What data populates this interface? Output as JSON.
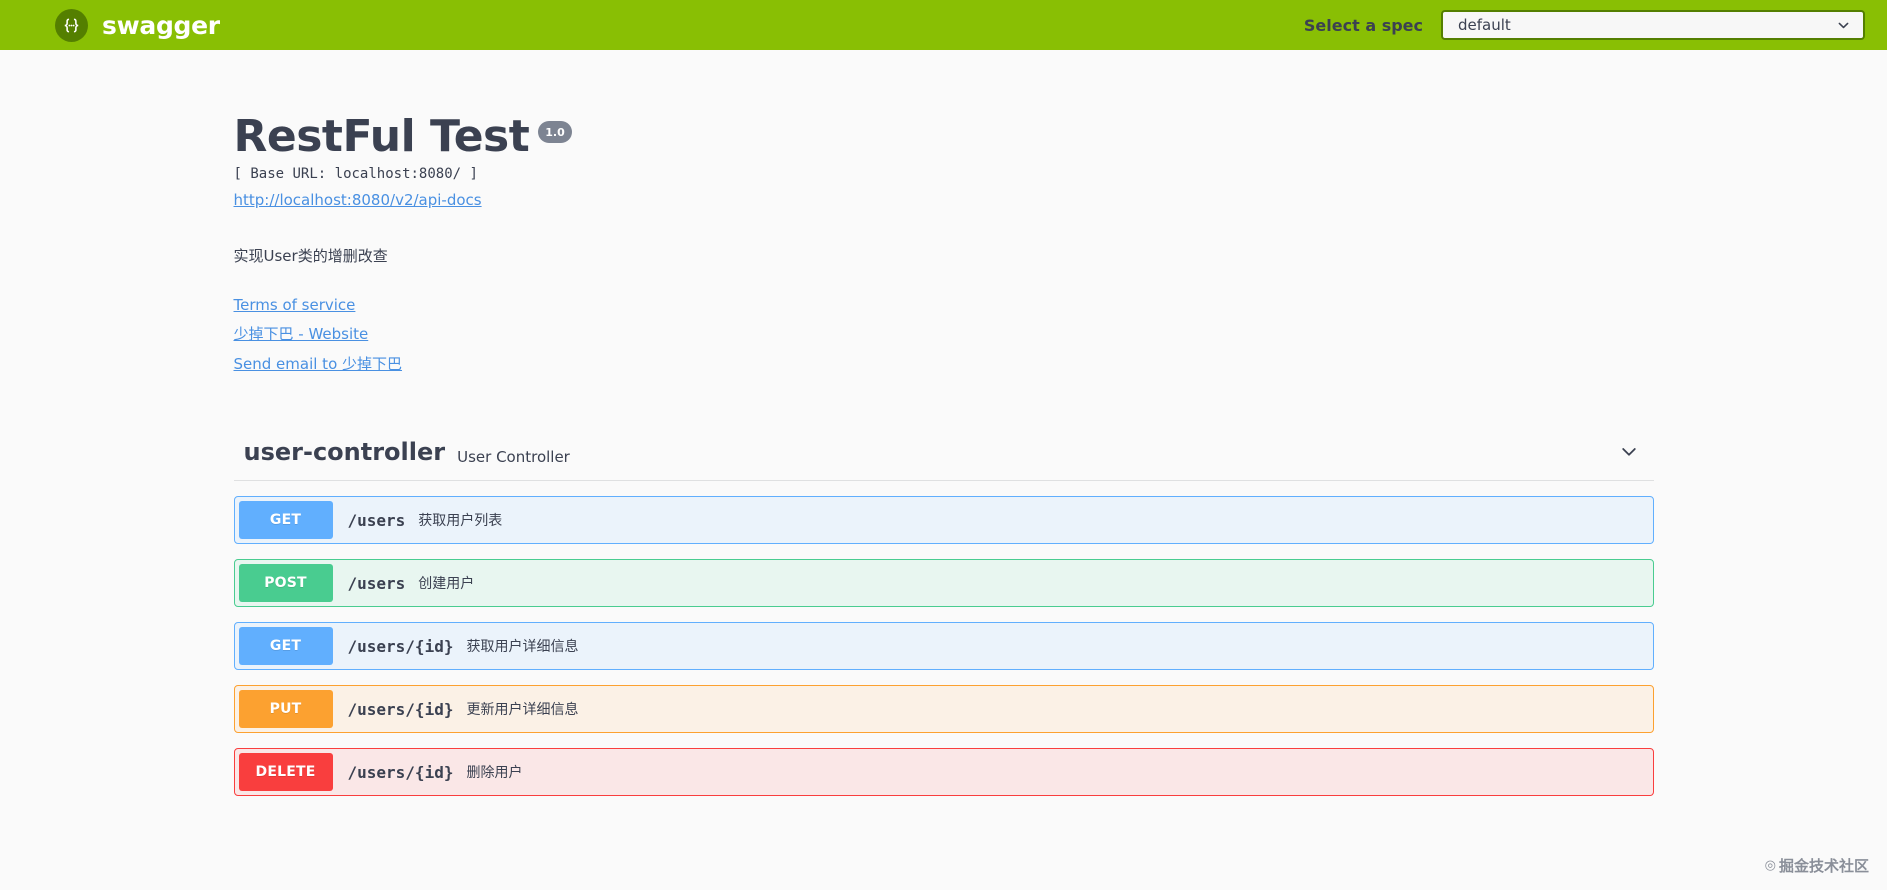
{
  "topbar": {
    "logo_icon": "swagger-braces-logo-icon",
    "logo_text": "swagger",
    "spec_label": "Select a spec",
    "spec_selected": "default",
    "spec_options": [
      "default"
    ],
    "chevron_icon": "chevron-down-icon",
    "background_color": "#89bf04",
    "logo_circle_color": "#547f00"
  },
  "info": {
    "title": "RestFul Test",
    "version": "1.0",
    "base_url": "[ Base URL: localhost:8080/ ]",
    "docs_link": "http://localhost:8080/v2/api-docs",
    "description": "实现User类的增删改查",
    "terms_link": "Terms of service",
    "website_link": "少掉下巴 - Website",
    "email_link": "Send email to 少掉下巴",
    "link_color": "#4990e2",
    "badge_color": "#7d8492"
  },
  "tag": {
    "name": "user-controller",
    "description": "User Controller",
    "toggle_icon": "chevron-down-icon"
  },
  "operations": [
    {
      "method": "GET",
      "path": "/users",
      "summary": "获取用户列表",
      "style": "op-get",
      "color": "#61affe"
    },
    {
      "method": "POST",
      "path": "/users",
      "summary": "创建用户",
      "style": "op-post",
      "color": "#49cc90"
    },
    {
      "method": "GET",
      "path": "/users/{id}",
      "summary": "获取用户详细信息",
      "style": "op-get",
      "color": "#61affe"
    },
    {
      "method": "PUT",
      "path": "/users/{id}",
      "summary": "更新用户详细信息",
      "style": "op-put",
      "color": "#fca130"
    },
    {
      "method": "DELETE",
      "path": "/users/{id}",
      "summary": "删除用户",
      "style": "op-delete",
      "color": "#f93e3e"
    }
  ],
  "watermark": {
    "mark": "◎",
    "text": "掘金技术社区"
  }
}
